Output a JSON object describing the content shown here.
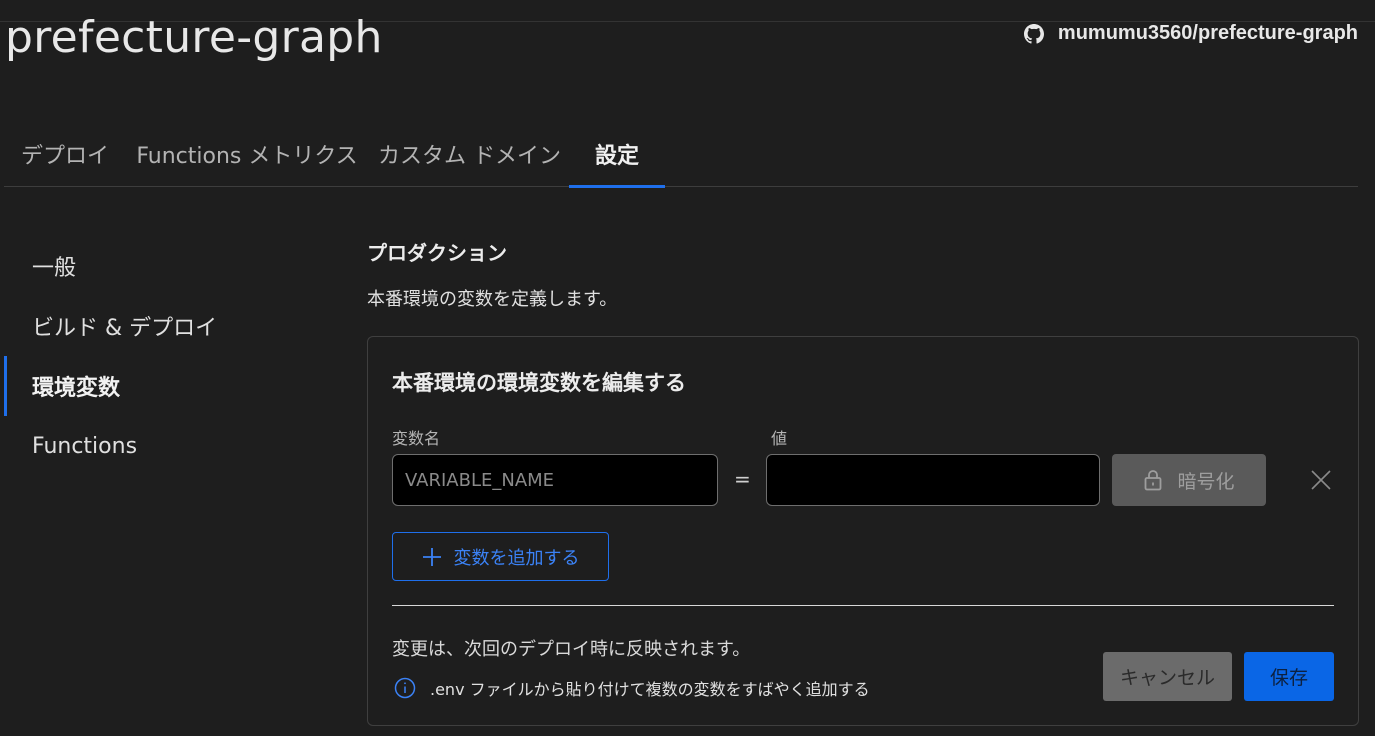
{
  "header": {
    "title": "prefecture-graph",
    "repo_icon": "github-icon",
    "repo_label": "mumumu3560/prefecture-graph"
  },
  "tabs": [
    {
      "label": "デプロイ",
      "active": false
    },
    {
      "label": "Functions メトリクス",
      "active": false
    },
    {
      "label": "カスタム ドメイン",
      "active": false
    },
    {
      "label": "設定",
      "active": true
    }
  ],
  "sidebar": {
    "items": [
      {
        "label": "一般",
        "active": false
      },
      {
        "label": "ビルド & デプロイ",
        "active": false
      },
      {
        "label": "環境変数",
        "active": true
      },
      {
        "label": "Functions",
        "active": false
      }
    ]
  },
  "main": {
    "section_title": "プロダクション",
    "section_desc": "本番環境の変数を定義します。",
    "card": {
      "title": "本番環境の環境変数を編集する",
      "name_label": "変数名",
      "value_label": "値",
      "name_placeholder": "VARIABLE_NAME",
      "name_value": "",
      "value_value": "",
      "equals": "=",
      "encrypt_label": "暗号化",
      "encrypt_icon": "lock-icon",
      "remove_icon": "close-icon",
      "add_label": "変数を追加する",
      "add_icon": "plus-icon",
      "note": "変更は、次回のデプロイ時に反映されます。",
      "info_icon": "info-icon",
      "info_text": ".env ファイルから貼り付けて複数の変数をすばやく追加する",
      "cancel_label": "キャンセル",
      "save_label": "保存"
    }
  },
  "colors": {
    "background": "#1e1e1e",
    "accent": "#1f6feb",
    "save_button": "#0a66e6",
    "cancel_button": "#6b6b6b",
    "disabled_button": "#5a5a5a"
  }
}
